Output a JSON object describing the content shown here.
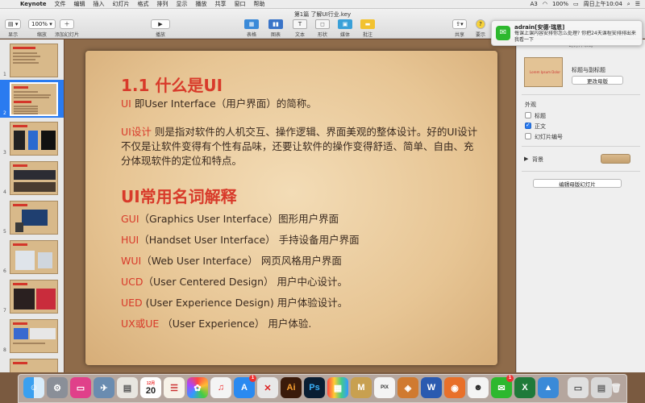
{
  "menubar": {
    "apple": "",
    "app": "Keynote",
    "items": [
      "文件",
      "编辑",
      "插入",
      "幻灯片",
      "格式",
      "排列",
      "显示",
      "播放",
      "共享",
      "窗口",
      "帮助"
    ],
    "status": [
      "A3",
      "100%",
      "周日上午10:04"
    ]
  },
  "toolbar": {
    "doc_title": "第1篇 了解UI行业.key",
    "view_label": "显示",
    "zoom_value": "100%",
    "zoom_label": "缩放",
    "add_slide_label": "添加幻灯片",
    "play_label": "播放",
    "table_label": "表格",
    "chart_label": "图表",
    "text_label": "文本",
    "shape_label": "形状",
    "media_label": "媒体",
    "comment_label": "批注",
    "share_label": "共享",
    "tips_label": "要示"
  },
  "navigator": {
    "slides": [
      "1",
      "2",
      "3",
      "4",
      "5",
      "6",
      "7",
      "8"
    ]
  },
  "slide": {
    "heading1": "1.1 什么是UI",
    "line1_red": "UI",
    "line1_rest": " 即User Interface（用户界面）的简称。",
    "para_red": "UI设计",
    "para_line1": " 则是指对软件的人机交互、操作逻辑、界面美观的整体设计。好的UI设计",
    "para_line2": "不仅是让软件变得有个性有品味，还要让软件的操作变得舒适、简单、自由、充",
    "para_line3": "分体现软件的定位和特点。",
    "heading2": "UI常用名词解释",
    "terms": [
      {
        "abbr": "GUI",
        "rest": "（Graphics User Interface）图形用户界面"
      },
      {
        "abbr": "HUI",
        "rest": "（Handset User Interface） 手持设备用户界面"
      },
      {
        "abbr": "WUI",
        "rest": "（Web User Interface）    网页风格用户界面"
      },
      {
        "abbr": "UCD",
        "rest": "（User Centered Design） 用户中心设计。"
      },
      {
        "abbr": "UED",
        "rest": " (User Experience Design)  用户体验设计。"
      },
      {
        "abbr": "UX或UE",
        "rest": " （User Experience）    用户体验."
      }
    ]
  },
  "inspector": {
    "tab": "幻灯片布局",
    "layout_thumb_text": "Lorem Ipsum Dolor",
    "layout_name": "标题与副标题",
    "change_master": "更改母版",
    "appearance": "外观",
    "opt_title": "标题",
    "opt_body": "正文",
    "opt_number": "幻灯片编号",
    "title_checked": false,
    "body_checked": true,
    "number_checked": false,
    "background": "背景",
    "edit_master": "编辑母版幻灯片"
  },
  "notification": {
    "title": "adrain[安德·瑞恩]",
    "body": "每课上课内容安排你怎么处理? 你把24天课程安排排出来我看一下"
  },
  "dock": {
    "calendar_month": "12月",
    "calendar_day": "20",
    "badge_appstore": "1",
    "badge_wechat": "1"
  },
  "colors": {
    "accent": "#d83a2a",
    "selection": "#2a7bf0",
    "slide_bg": "#e7c594"
  }
}
